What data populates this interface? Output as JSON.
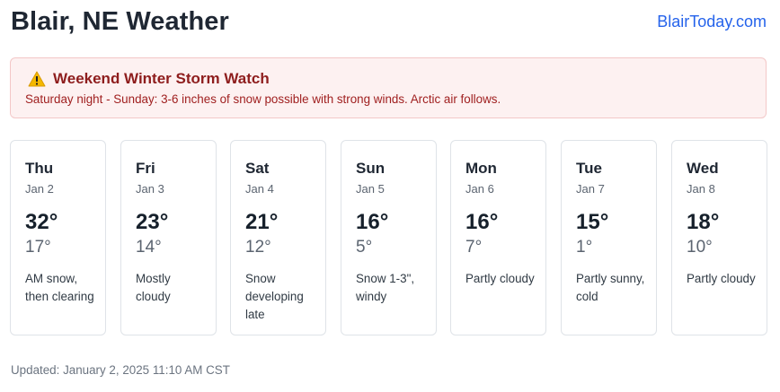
{
  "header": {
    "title": "Blair, NE Weather",
    "site_link": "BlairToday.com"
  },
  "alert": {
    "icon": "warning-icon",
    "title": "Weekend Winter Storm Watch",
    "text": "Saturday night - Sunday: 3-6 inches of snow possible with strong winds. Arctic air follows.",
    "colors": {
      "background": "#fdf1f1",
      "border": "#f3c7c7",
      "title": "#8e1d1d",
      "text": "#a02020"
    }
  },
  "forecast": [
    {
      "day": "Thu",
      "date": "Jan 2",
      "high": "32°",
      "low": "17°",
      "condition": "AM snow, then clearing"
    },
    {
      "day": "Fri",
      "date": "Jan 3",
      "high": "23°",
      "low": "14°",
      "condition": "Mostly cloudy"
    },
    {
      "day": "Sat",
      "date": "Jan 4",
      "high": "21°",
      "low": "12°",
      "condition": "Snow developing late"
    },
    {
      "day": "Sun",
      "date": "Jan 5",
      "high": "16°",
      "low": "5°",
      "condition": "Snow 1-3\", windy"
    },
    {
      "day": "Mon",
      "date": "Jan 6",
      "high": "16°",
      "low": "7°",
      "condition": "Partly cloudy"
    },
    {
      "day": "Tue",
      "date": "Jan 7",
      "high": "15°",
      "low": "1°",
      "condition": "Partly sunny, cold"
    },
    {
      "day": "Wed",
      "date": "Jan 8",
      "high": "18°",
      "low": "10°",
      "condition": "Partly cloudy"
    }
  ],
  "footer": {
    "updated": "Updated: January 2, 2025 11:10 AM CST"
  },
  "colors": {
    "link": "#2563eb",
    "title": "#1f2733"
  }
}
